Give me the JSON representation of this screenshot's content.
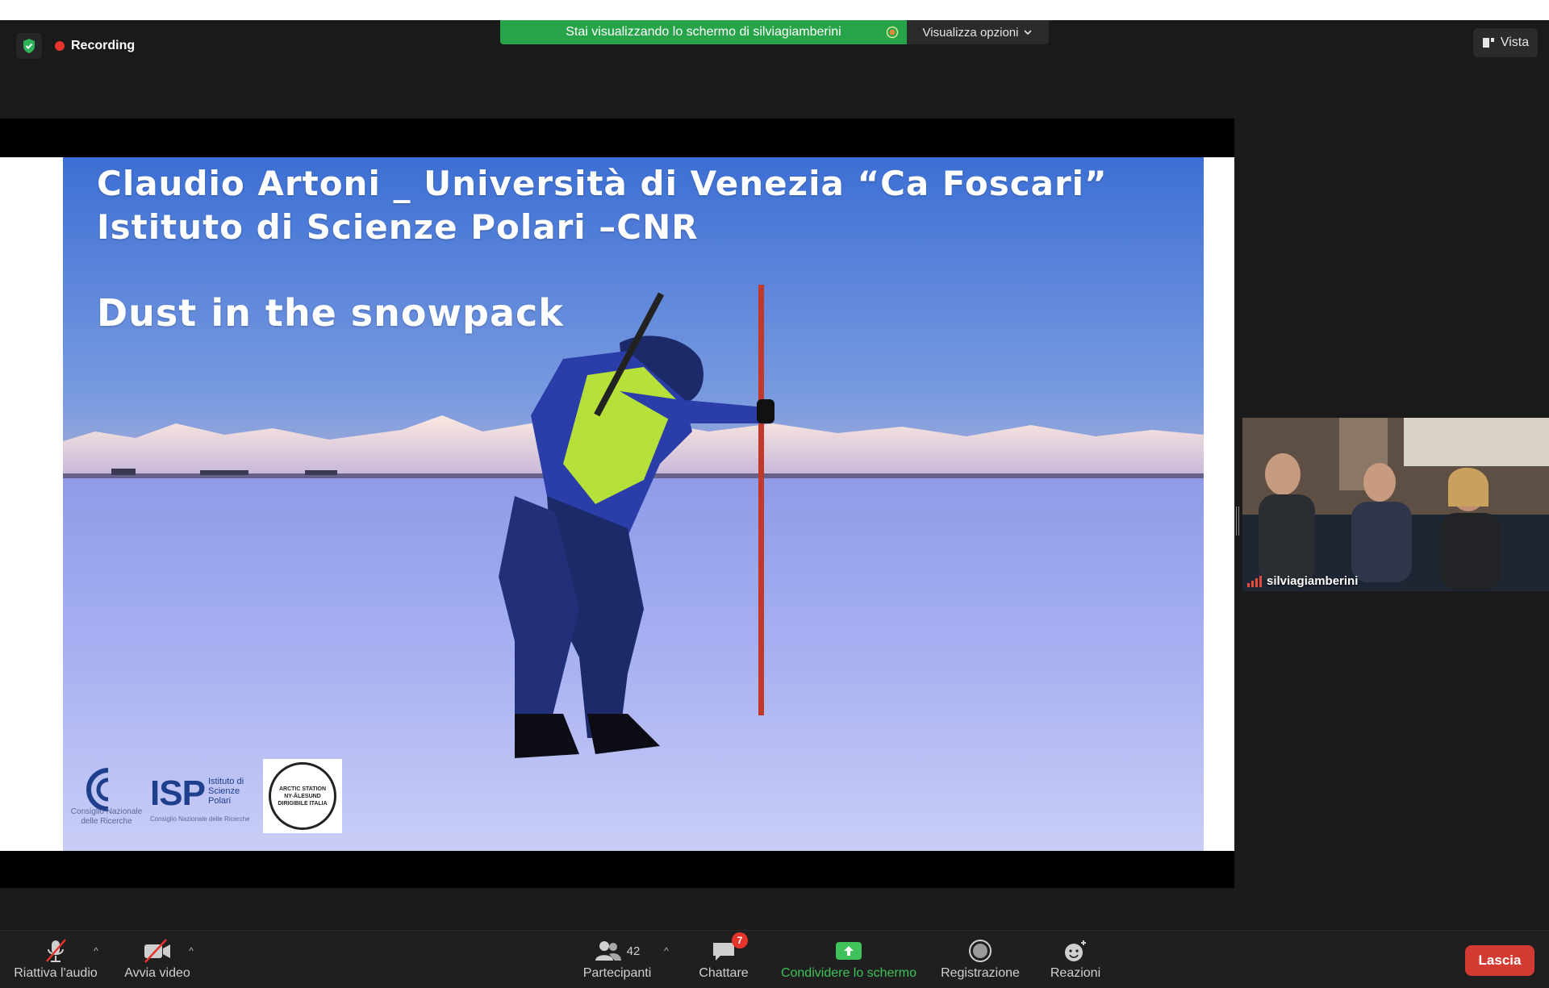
{
  "header": {
    "recording_label": "Recording",
    "share_banner_text": "Stai visualizzando lo schermo di silviagiamberini",
    "view_options_label": "Visualizza opzioni",
    "vista_label": "Vista"
  },
  "slide": {
    "line1": "Claudio Artoni _ Università di Venezia “Ca Foscari”",
    "line2": "Istituto di Scienze Polari –CNR",
    "line3": "Dust in the snowpack",
    "cnr_logo_text": "Consiglio Nazionale delle Ricerche",
    "isp_logo_text": "ISP",
    "isp_logo_sub": "Istituto di Scienze Polari",
    "isp_logo_foot": "Consiglio Nazionale delle Ricerche",
    "arctic_logo_top": "ARCTIC STATION",
    "arctic_logo_mid": "NY-ÅLESUND",
    "arctic_logo_bottom": "DIRIGIBILE ITALIA"
  },
  "video_tile": {
    "participant_name": "silviagiamberini"
  },
  "toolbar": {
    "audio_label": "Riattiva l'audio",
    "video_label": "Avvia video",
    "participants_label": "Partecipanti",
    "participants_count": "42",
    "chat_label": "Chattare",
    "chat_badge": "7",
    "share_label": "Condividere lo schermo",
    "record_label": "Registrazione",
    "reactions_label": "Reazioni",
    "leave_label": "Lascia"
  },
  "colors": {
    "share_green": "#27a34a",
    "leave_red": "#d33a32",
    "record_red": "#e5342c"
  }
}
